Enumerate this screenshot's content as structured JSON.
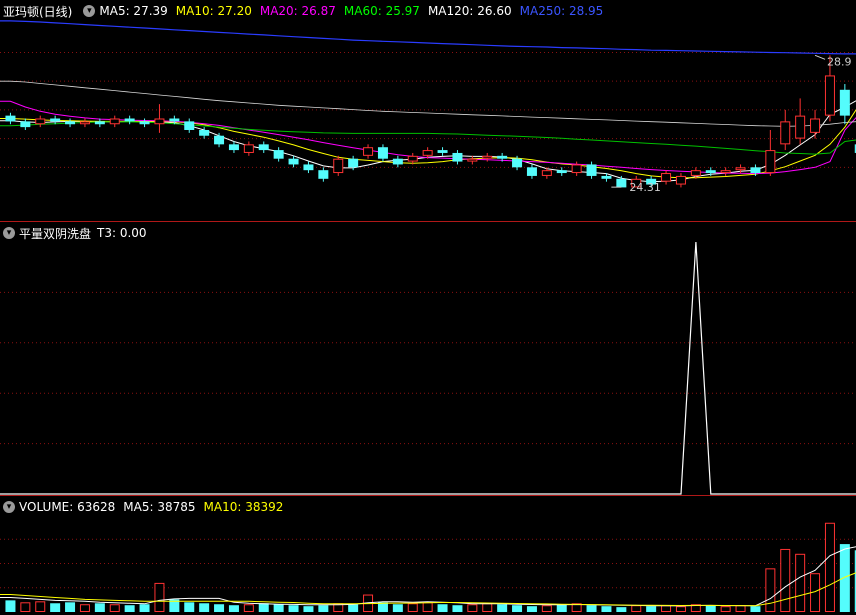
{
  "chart_data": [
    {
      "type": "candlestick",
      "title": "亚玛顿(日线)",
      "indicators": [
        {
          "label": "MA5: 27.39",
          "color": "#ffffff"
        },
        {
          "label": "MA10: 27.20",
          "color": "#ffff00"
        },
        {
          "label": "MA20: 26.87",
          "color": "#ff00ff"
        },
        {
          "label": "MA60: 25.97",
          "color": "#00ff00"
        },
        {
          "label": "MA120: 26.60",
          "color": "#ffffff"
        },
        {
          "label": "MA250: 28.95",
          "color": "#3b55ff"
        }
      ],
      "ylim": [
        23.2,
        30.2
      ],
      "candles": [
        {
          "o": 26.8,
          "c": 26.6,
          "h": 26.9,
          "l": 26.5
        },
        {
          "o": 26.6,
          "c": 26.4,
          "h": 26.7,
          "l": 26.3
        },
        {
          "o": 26.5,
          "c": 26.7,
          "h": 26.8,
          "l": 26.4
        },
        {
          "o": 26.7,
          "c": 26.6,
          "h": 26.8,
          "l": 26.5
        },
        {
          "o": 26.6,
          "c": 26.5,
          "h": 26.7,
          "l": 26.4
        },
        {
          "o": 26.5,
          "c": 26.6,
          "h": 26.7,
          "l": 26.4
        },
        {
          "o": 26.6,
          "c": 26.5,
          "h": 26.7,
          "l": 26.4
        },
        {
          "o": 26.5,
          "c": 26.7,
          "h": 26.8,
          "l": 26.4
        },
        {
          "o": 26.7,
          "c": 26.6,
          "h": 26.8,
          "l": 26.5
        },
        {
          "o": 26.6,
          "c": 26.5,
          "h": 26.7,
          "l": 26.4
        },
        {
          "o": 26.5,
          "c": 26.7,
          "h": 27.2,
          "l": 26.2
        },
        {
          "o": 26.7,
          "c": 26.6,
          "h": 26.8,
          "l": 26.5
        },
        {
          "o": 26.6,
          "c": 26.3,
          "h": 26.7,
          "l": 26.2
        },
        {
          "o": 26.3,
          "c": 26.1,
          "h": 26.4,
          "l": 26.0
        },
        {
          "o": 26.1,
          "c": 25.8,
          "h": 26.2,
          "l": 25.7
        },
        {
          "o": 25.8,
          "c": 25.6,
          "h": 25.9,
          "l": 25.5
        },
        {
          "o": 25.5,
          "c": 25.8,
          "h": 25.9,
          "l": 25.4
        },
        {
          "o": 25.8,
          "c": 25.6,
          "h": 25.9,
          "l": 25.5
        },
        {
          "o": 25.6,
          "c": 25.3,
          "h": 25.7,
          "l": 25.2
        },
        {
          "o": 25.3,
          "c": 25.1,
          "h": 25.4,
          "l": 25.0
        },
        {
          "o": 25.1,
          "c": 24.9,
          "h": 25.2,
          "l": 24.8
        },
        {
          "o": 24.9,
          "c": 24.6,
          "h": 25.0,
          "l": 24.5
        },
        {
          "o": 24.8,
          "c": 25.3,
          "h": 25.4,
          "l": 24.7
        },
        {
          "o": 25.3,
          "c": 25.0,
          "h": 25.4,
          "l": 24.9
        },
        {
          "o": 25.4,
          "c": 25.7,
          "h": 25.8,
          "l": 25.3
        },
        {
          "o": 25.7,
          "c": 25.3,
          "h": 25.8,
          "l": 25.2
        },
        {
          "o": 25.3,
          "c": 25.1,
          "h": 25.4,
          "l": 25.0
        },
        {
          "o": 25.2,
          "c": 25.4,
          "h": 25.5,
          "l": 25.1
        },
        {
          "o": 25.4,
          "c": 25.6,
          "h": 25.7,
          "l": 25.3
        },
        {
          "o": 25.6,
          "c": 25.5,
          "h": 25.7,
          "l": 25.4
        },
        {
          "o": 25.5,
          "c": 25.2,
          "h": 25.6,
          "l": 25.1
        },
        {
          "o": 25.2,
          "c": 25.3,
          "h": 25.4,
          "l": 25.1
        },
        {
          "o": 25.3,
          "c": 25.4,
          "h": 25.5,
          "l": 25.2
        },
        {
          "o": 25.4,
          "c": 25.3,
          "h": 25.5,
          "l": 25.2
        },
        {
          "o": 25.3,
          "c": 25.0,
          "h": 25.4,
          "l": 24.9
        },
        {
          "o": 25.0,
          "c": 24.7,
          "h": 25.1,
          "l": 24.6
        },
        {
          "o": 24.7,
          "c": 24.9,
          "h": 25.0,
          "l": 24.6
        },
        {
          "o": 24.9,
          "c": 24.8,
          "h": 25.0,
          "l": 24.7
        },
        {
          "o": 24.8,
          "c": 25.1,
          "h": 25.2,
          "l": 24.7
        },
        {
          "o": 25.1,
          "c": 24.7,
          "h": 25.2,
          "l": 24.6
        },
        {
          "o": 24.7,
          "c": 24.6,
          "h": 24.8,
          "l": 24.5
        },
        {
          "o": 24.6,
          "c": 24.3,
          "h": 24.7,
          "l": 24.31
        },
        {
          "o": 24.3,
          "c": 24.6,
          "h": 24.7,
          "l": 24.31
        },
        {
          "o": 24.6,
          "c": 24.4,
          "h": 24.7,
          "l": 24.3
        },
        {
          "o": 24.5,
          "c": 24.8,
          "h": 24.9,
          "l": 24.4
        },
        {
          "o": 24.4,
          "c": 24.7,
          "h": 24.8,
          "l": 24.3
        },
        {
          "o": 24.7,
          "c": 24.9,
          "h": 25.0,
          "l": 24.6
        },
        {
          "o": 24.9,
          "c": 24.8,
          "h": 25.0,
          "l": 24.7
        },
        {
          "o": 24.8,
          "c": 24.9,
          "h": 25.0,
          "l": 24.7
        },
        {
          "o": 24.9,
          "c": 25.0,
          "h": 25.1,
          "l": 24.8
        },
        {
          "o": 25.0,
          "c": 24.8,
          "h": 25.1,
          "l": 24.7
        },
        {
          "o": 24.8,
          "c": 25.6,
          "h": 26.3,
          "l": 24.7
        },
        {
          "o": 25.8,
          "c": 26.6,
          "h": 27.0,
          "l": 25.6
        },
        {
          "o": 26.0,
          "c": 26.8,
          "h": 27.4,
          "l": 25.8
        },
        {
          "o": 26.2,
          "c": 26.7,
          "h": 27.0,
          "l": 26.0
        },
        {
          "o": 26.8,
          "c": 28.2,
          "h": 28.9,
          "l": 26.6
        },
        {
          "o": 27.7,
          "c": 26.8,
          "h": 27.9,
          "l": 26.5
        },
        {
          "o": 25.8,
          "c": 25.5,
          "h": 26.0,
          "l": 25.0
        }
      ],
      "ma_lines": {
        "MA5": [
          26.62,
          26.58,
          26.56,
          26.58,
          26.6,
          26.6,
          26.58,
          26.58,
          26.6,
          26.6,
          26.58,
          26.55,
          26.45,
          26.3,
          26.1,
          25.9,
          25.75,
          25.65,
          25.55,
          25.4,
          25.22,
          25.05,
          24.98,
          24.98,
          25.08,
          25.2,
          25.25,
          25.28,
          25.35,
          25.38,
          25.4,
          25.38,
          25.38,
          25.36,
          25.28,
          25.12,
          24.95,
          24.88,
          24.85,
          24.82,
          24.78,
          24.62,
          24.54,
          24.5,
          24.52,
          24.56,
          24.68,
          24.76,
          24.8,
          24.86,
          24.9,
          25.1,
          25.42,
          25.78,
          26.14,
          26.84,
          27.1,
          27.39
        ],
        "MA10": [
          26.7,
          26.68,
          26.65,
          26.63,
          26.62,
          26.61,
          26.6,
          26.6,
          26.6,
          26.6,
          26.6,
          26.58,
          26.55,
          26.48,
          26.38,
          26.25,
          26.15,
          26.05,
          25.92,
          25.78,
          25.62,
          25.48,
          25.35,
          25.28,
          25.24,
          25.2,
          25.16,
          25.14,
          25.16,
          25.2,
          25.26,
          25.3,
          25.32,
          25.34,
          25.32,
          25.26,
          25.18,
          25.12,
          25.08,
          25.02,
          24.96,
          24.88,
          24.78,
          24.7,
          24.66,
          24.64,
          24.64,
          24.66,
          24.68,
          24.72,
          24.76,
          24.88,
          25.02,
          25.22,
          25.42,
          25.8,
          26.4,
          27.2
        ],
        "MA20": [
          27.3,
          27.1,
          26.95,
          26.85,
          26.78,
          26.72,
          26.68,
          26.66,
          26.64,
          26.63,
          26.62,
          26.6,
          26.57,
          26.52,
          26.46,
          26.38,
          26.3,
          26.22,
          26.14,
          26.05,
          25.96,
          25.86,
          25.77,
          25.68,
          25.6,
          25.52,
          25.44,
          25.38,
          25.34,
          25.32,
          25.3,
          25.28,
          25.26,
          25.24,
          25.22,
          25.2,
          25.17,
          25.14,
          25.11,
          25.08,
          25.04,
          25.0,
          24.96,
          24.92,
          24.89,
          24.86,
          24.84,
          24.82,
          24.8,
          24.79,
          24.78,
          24.8,
          24.85,
          24.92,
          25.0,
          25.2,
          26.3,
          26.87
        ],
        "MA60": [
          26.45,
          26.47,
          26.5,
          26.52,
          26.54,
          26.56,
          26.58,
          26.58,
          26.58,
          26.57,
          26.55,
          26.52,
          26.48,
          26.44,
          26.4,
          26.36,
          26.32,
          26.29,
          26.26,
          26.24,
          26.22,
          26.2,
          26.19,
          26.18,
          26.18,
          26.18,
          26.18,
          26.18,
          26.18,
          26.17,
          26.16,
          26.14,
          26.12,
          26.1,
          26.08,
          26.06,
          26.04,
          26.01,
          25.98,
          25.95,
          25.92,
          25.89,
          25.86,
          25.83,
          25.8,
          25.77,
          25.74,
          25.7,
          25.66,
          25.62,
          25.58,
          25.54,
          25.5,
          25.48,
          25.46,
          25.5,
          25.9,
          25.97
        ],
        "MA120": [
          28.0,
          27.97,
          27.92,
          27.87,
          27.82,
          27.77,
          27.72,
          27.67,
          27.62,
          27.57,
          27.52,
          27.47,
          27.42,
          27.37,
          27.32,
          27.28,
          27.24,
          27.2,
          27.16,
          27.13,
          27.1,
          27.07,
          27.04,
          27.01,
          26.98,
          26.95,
          26.93,
          26.91,
          26.89,
          26.87,
          26.85,
          26.83,
          26.81,
          26.79,
          26.77,
          26.75,
          26.73,
          26.71,
          26.69,
          26.67,
          26.65,
          26.63,
          26.61,
          26.59,
          26.57,
          26.55,
          26.53,
          26.51,
          26.49,
          26.47,
          26.45,
          26.44,
          26.43,
          26.44,
          26.46,
          26.5,
          26.56,
          26.6
        ],
        "MA250": [
          30.1,
          30.08,
          30.06,
          30.03,
          30.0,
          29.97,
          29.94,
          29.91,
          29.88,
          29.85,
          29.82,
          29.79,
          29.76,
          29.73,
          29.7,
          29.67,
          29.64,
          29.61,
          29.58,
          29.55,
          29.52,
          29.49,
          29.46,
          29.43,
          29.41,
          29.39,
          29.37,
          29.35,
          29.33,
          29.31,
          29.29,
          29.27,
          29.25,
          29.23,
          29.21,
          29.2,
          29.19,
          29.17,
          29.16,
          29.14,
          29.13,
          29.11,
          29.1,
          29.08,
          29.07,
          29.06,
          29.05,
          29.04,
          29.03,
          29.02,
          29.01,
          29.0,
          28.99,
          28.98,
          28.97,
          28.96,
          28.95,
          28.95
        ]
      },
      "annotations": [
        {
          "label": "28.9",
          "index": 54,
          "value": 28.9
        },
        {
          "label": "24.31",
          "index": 41,
          "value": 24.31
        }
      ],
      "grid": true
    },
    {
      "type": "line",
      "title": "平量双阴洗盘",
      "indicators": [
        {
          "label": "T3: 0.00",
          "color": "#ffffff"
        }
      ],
      "ylim": [
        0,
        1
      ],
      "values": [
        0,
        0,
        0,
        0,
        0,
        0,
        0,
        0,
        0,
        0,
        0,
        0,
        0,
        0,
        0,
        0,
        0,
        0,
        0,
        0,
        0,
        0,
        0,
        0,
        0,
        0,
        0,
        0,
        0,
        0,
        0,
        0,
        0,
        0,
        0,
        0,
        0,
        0,
        0,
        0,
        0,
        0,
        0,
        0,
        0,
        0,
        0,
        0,
        0,
        0,
        0,
        0,
        0,
        0,
        0,
        0,
        0,
        0
      ],
      "spike_index": 46,
      "spike_value": 1,
      "grid": true
    },
    {
      "type": "bar",
      "title": "VOLUME: 63628",
      "indicators": [
        {
          "label": "MA5: 38785",
          "color": "#ffffff"
        },
        {
          "label": "MA10: 38392",
          "color": "#ffff00"
        }
      ],
      "ylim": [
        0,
        100000
      ],
      "values": [
        12000,
        10000,
        11000,
        9000,
        10000,
        8000,
        9000,
        8000,
        7000,
        8000,
        30000,
        13000,
        10000,
        9000,
        8000,
        7000,
        8000,
        9000,
        8000,
        7000,
        6000,
        7000,
        9000,
        8000,
        18000,
        10000,
        8000,
        9000,
        10000,
        8000,
        7000,
        8000,
        9000,
        8000,
        7000,
        6000,
        7000,
        8000,
        9000,
        7000,
        6000,
        5000,
        7000,
        6000,
        7000,
        6000,
        8000,
        7000,
        6000,
        7000,
        6000,
        45000,
        65000,
        60000,
        40000,
        92000,
        70000,
        63628
      ],
      "rising": [
        false,
        true,
        true,
        false,
        false,
        true,
        false,
        true,
        false,
        false,
        true,
        false,
        false,
        false,
        false,
        false,
        true,
        false,
        false,
        false,
        false,
        false,
        true,
        false,
        true,
        false,
        false,
        true,
        true,
        false,
        false,
        true,
        true,
        false,
        false,
        false,
        true,
        false,
        true,
        false,
        false,
        false,
        true,
        false,
        true,
        true,
        true,
        false,
        true,
        true,
        false,
        true,
        true,
        true,
        true,
        true,
        false,
        false
      ],
      "ma5": [
        15000,
        14000,
        13000,
        12000,
        11500,
        11000,
        10000,
        9500,
        9000,
        8500,
        12000,
        13500,
        14000,
        14000,
        14000,
        10000,
        9000,
        8500,
        8000,
        7800,
        7500,
        7400,
        7500,
        7800,
        9500,
        10500,
        10500,
        10000,
        10500,
        10000,
        9500,
        8500,
        8500,
        8500,
        8000,
        7700,
        7500,
        7500,
        7700,
        7500,
        7200,
        7000,
        6800,
        6500,
        6500,
        6300,
        6700,
        6800,
        6600,
        6600,
        6500,
        13800,
        26000,
        36000,
        43000,
        58000,
        65000,
        68000
      ],
      "ma10": [
        18000,
        17000,
        16000,
        15000,
        14000,
        13000,
        12500,
        12000,
        11500,
        11000,
        11000,
        11000,
        11000,
        11000,
        11000,
        11000,
        11000,
        10500,
        10000,
        9800,
        9000,
        8500,
        8500,
        8500,
        8700,
        9000,
        9200,
        9200,
        9500,
        9800,
        9800,
        9500,
        9300,
        9000,
        8800,
        8500,
        8300,
        8000,
        7800,
        7600,
        7400,
        7200,
        7000,
        6900,
        6800,
        6700,
        6800,
        6800,
        6700,
        6600,
        6500,
        9000,
        13000,
        17000,
        21000,
        28000,
        36000,
        42000
      ]
    }
  ]
}
